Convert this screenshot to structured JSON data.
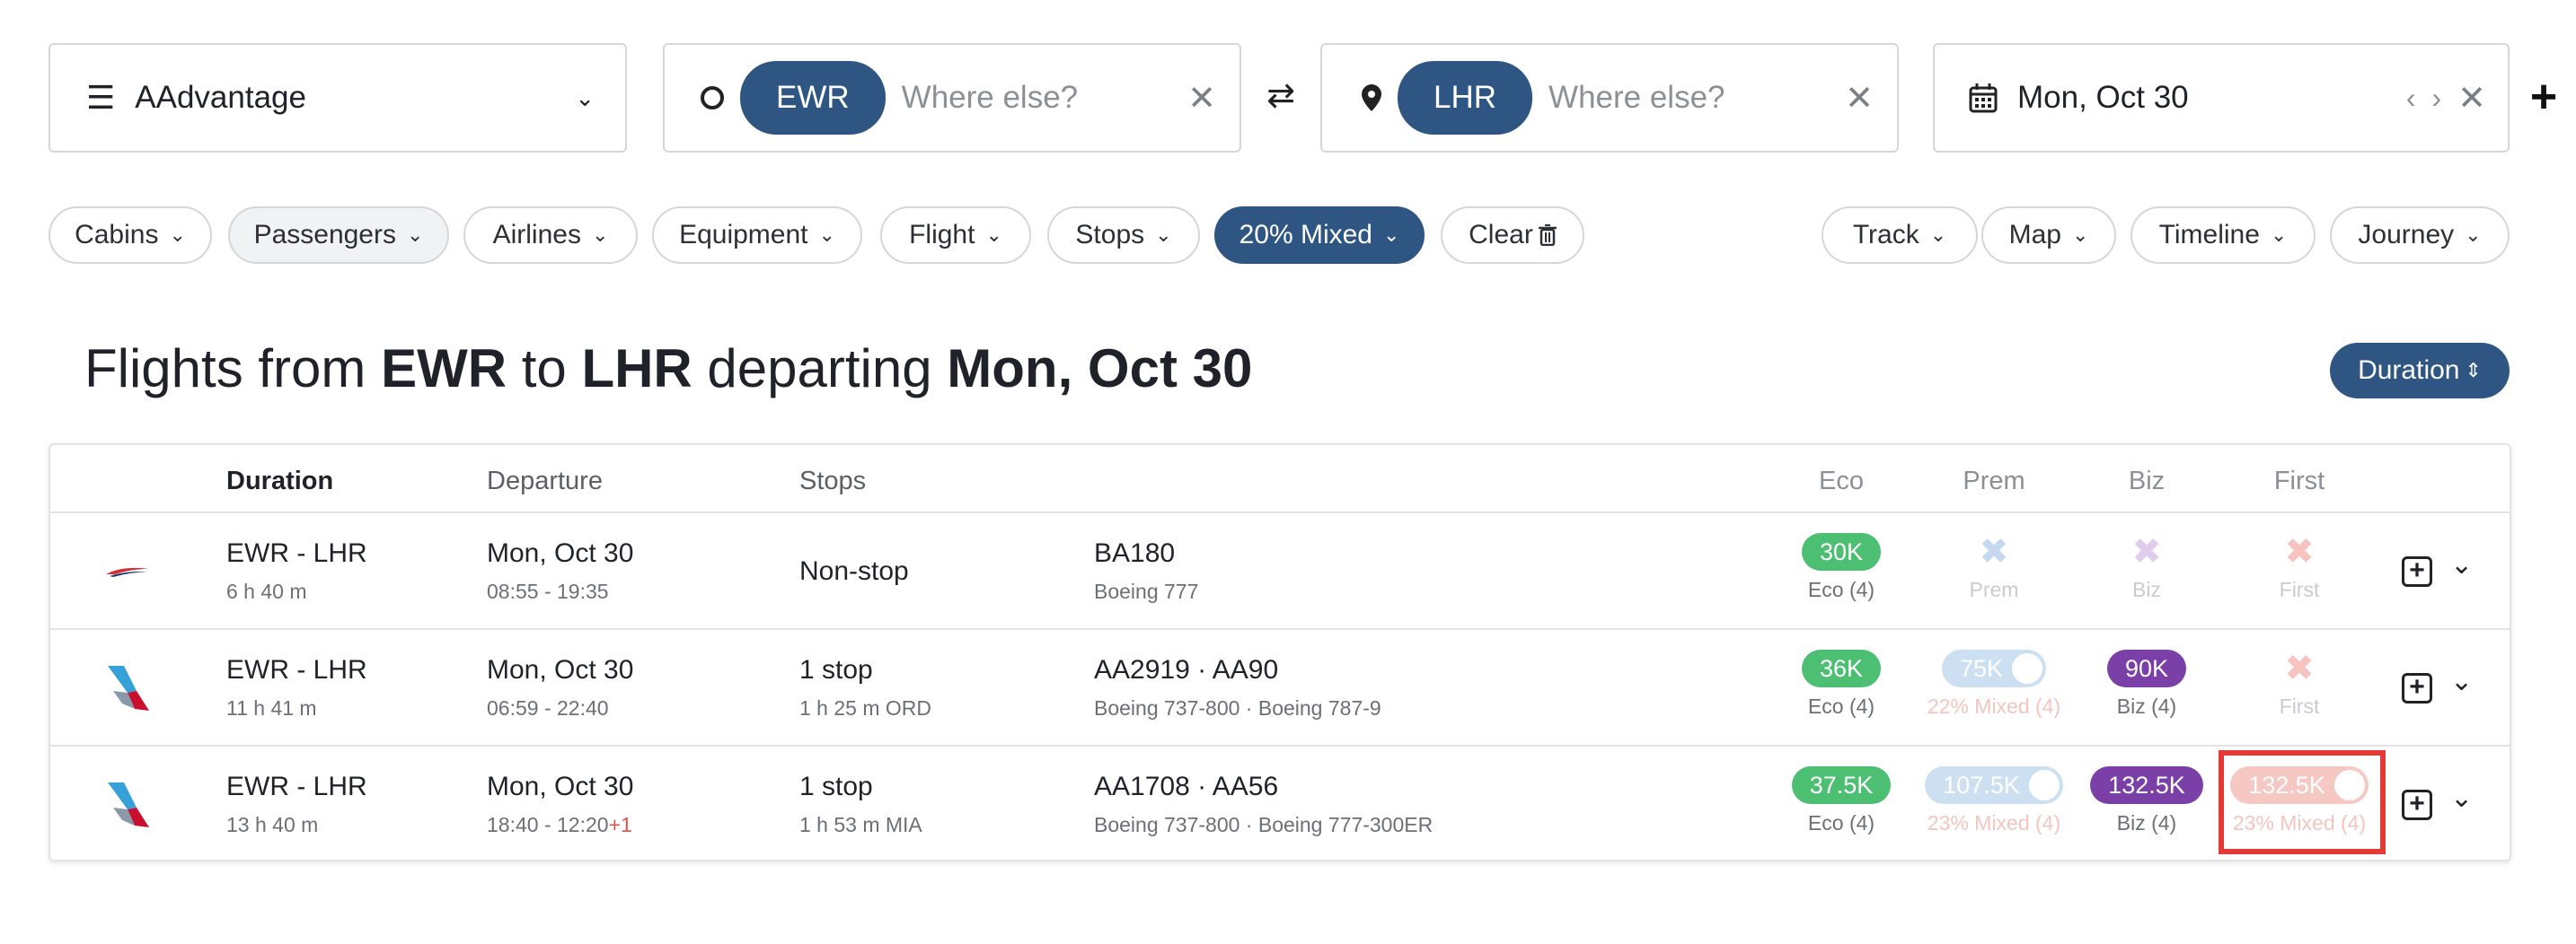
{
  "search": {
    "program": "AAdvantage",
    "origin_code": "EWR",
    "origin_placeholder": "Where else?",
    "destination_code": "LHR",
    "destination_placeholder": "Where else?",
    "date": "Mon, Oct 30"
  },
  "filters": {
    "cabins": "Cabins",
    "passengers": "Passengers",
    "airlines": "Airlines",
    "equipment": "Equipment",
    "flight": "Flight",
    "stops": "Stops",
    "mixed": "20% Mixed",
    "clear": "Clear",
    "track": "Track",
    "map": "Map",
    "timeline": "Timeline",
    "journey": "Journey"
  },
  "heading": {
    "prefix": "Flights from",
    "from": "EWR",
    "to_word": "to",
    "to": "LHR",
    "departing": "departing",
    "date": "Mon, Oct 30"
  },
  "sort_label": "Duration",
  "columns": {
    "duration": "Duration",
    "departure": "Departure",
    "stops": "Stops",
    "eco": "Eco",
    "prem": "Prem",
    "biz": "Biz",
    "first": "First"
  },
  "rows": [
    {
      "airline": "British Airways",
      "route": "EWR - LHR",
      "duration": "6 h 40 m",
      "date": "Mon, Oct 30",
      "times": "08:55 - 19:35",
      "stops": "Non-stop",
      "stop_detail": "",
      "flights": "BA180",
      "aircraft": "Boeing 777",
      "eco": {
        "value": "30K",
        "label": "Eco (4)"
      },
      "prem": {
        "value": "✖",
        "label": "Prem"
      },
      "biz": {
        "value": "✖",
        "label": "Biz"
      },
      "first": {
        "value": "✖",
        "label": "First"
      }
    },
    {
      "airline": "American Airlines",
      "route": "EWR - LHR",
      "duration": "11 h 41 m",
      "date": "Mon, Oct 30",
      "times": "06:59 - 22:40",
      "stops": "1 stop",
      "stop_detail": "1 h 25 m  ORD",
      "flights": "AA2919 · AA90",
      "aircraft": "Boeing 737-800 · Boeing 787-9",
      "eco": {
        "value": "36K",
        "label": "Eco (4)"
      },
      "prem": {
        "value": "75K",
        "label": "22% Mixed (4)"
      },
      "biz": {
        "value": "90K",
        "label": "Biz (4)"
      },
      "first": {
        "value": "✖",
        "label": "First"
      }
    },
    {
      "airline": "American Airlines",
      "route": "EWR - LHR",
      "duration": "13 h 40 m",
      "date": "Mon, Oct 30",
      "times": "18:40 - 12:20",
      "day_offset": "+1",
      "stops": "1 stop",
      "stop_detail": "1 h 53 m  MIA",
      "flights": "AA1708 · AA56",
      "aircraft": "Boeing 737-800 · Boeing 777-300ER",
      "eco": {
        "value": "37.5K",
        "label": "Eco (4)"
      },
      "prem": {
        "value": "107.5K",
        "label": "23% Mixed (4)"
      },
      "biz": {
        "value": "132.5K",
        "label": "Biz (4)"
      },
      "first": {
        "value": "132.5K",
        "label": "23% Mixed (4)"
      }
    }
  ],
  "colors": {
    "accent": "#2f5682",
    "eco_green": "#4cbf73",
    "biz_purple": "#7b3fa8",
    "highlight_red": "#e53935"
  }
}
